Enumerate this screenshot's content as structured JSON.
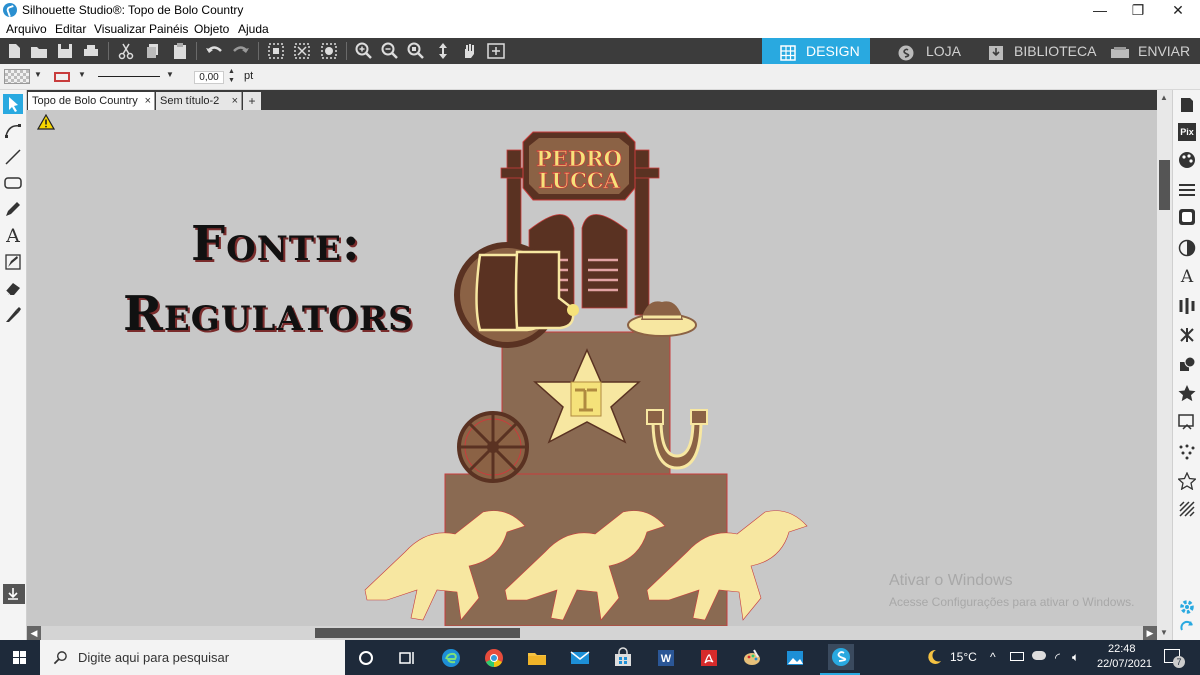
{
  "window": {
    "title": "Silhouette Studio®: Topo de Bolo Country",
    "minimize": "—",
    "maximize": "❐",
    "close": "✕"
  },
  "menu": [
    "Arquivo",
    "Editar",
    "Visualizar",
    "Painéis",
    "Objeto",
    "Ajuda"
  ],
  "nav_tabs": {
    "design": "DESIGN",
    "loja": "LOJA",
    "biblioteca": "BIBLIOTECA",
    "enviar": "ENVIAR"
  },
  "properties": {
    "line_width": "0,00",
    "unit": "pt"
  },
  "doc_tabs": [
    {
      "label": "Topo de Bolo Country",
      "close": "×"
    },
    {
      "label": "Sem título-2",
      "close": "×"
    }
  ],
  "add_tab": "+",
  "design": {
    "heading_line1": "Fonte:",
    "heading_line2": "Regulators",
    "sign_line1": "PEDRO",
    "sign_line2": "LUCCA",
    "colors": {
      "brown_dark": "#5a3222",
      "brown_mid": "#8b6245",
      "cake_tier": "#8a6a52",
      "cream": "#f7e7a1",
      "sign_yellow": "#f5e27a",
      "accent_red": "#c83c3c"
    }
  },
  "watermark": {
    "title": "Ativar o Windows",
    "subtitle": "Acesse Configurações para ativar o Windows."
  },
  "taskbar": {
    "search_placeholder": "Digite aqui para pesquisar",
    "weather": "15°C",
    "time": "22:48",
    "date": "22/07/2021",
    "notifications": "7"
  }
}
